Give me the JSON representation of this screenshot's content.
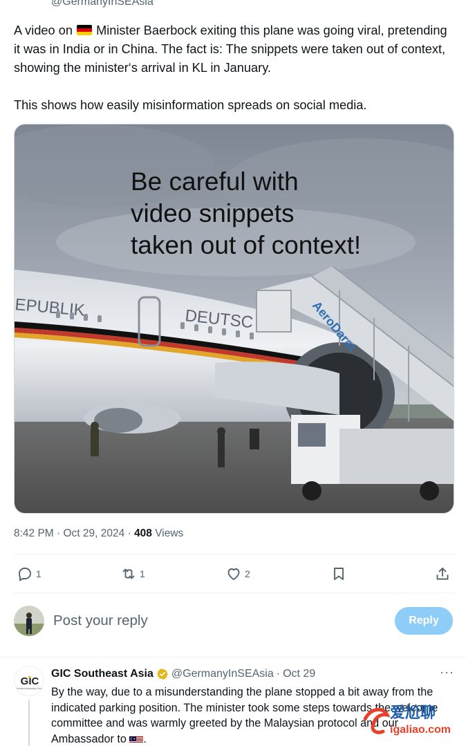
{
  "tweet": {
    "handle_top": "@GermanyInSEAsia",
    "text_line1_pre": "A video on",
    "text_line1_post": "Minister Baerbock exiting this plane was going viral, pretending it was in India or in China.  The fact is: The snippets were taken out of context, showing the minister‘s arrival in KL in January.",
    "text_line2": "This shows how easily misinformation spreads on social media.",
    "flag": "germany-flag"
  },
  "media": {
    "overlay_line1": "Be careful with",
    "overlay_line2": "video snippets",
    "overlay_line3": "taken out of context!",
    "fuselage_text_left": "EPUBLIK",
    "fuselage_text_right": "DEUTSC",
    "stairs_brand": "AeroDarat"
  },
  "meta": {
    "time": "8:42 PM",
    "sep1": " · ",
    "date": "Oct 29, 2024",
    "sep2": " · ",
    "views_count": "408",
    "views_label": " Views"
  },
  "actions": {
    "replies": "1",
    "reposts": "1",
    "likes": "2"
  },
  "reply_box": {
    "placeholder": "Post your reply",
    "button": "Reply"
  },
  "reply": {
    "avatar_text": "GIC",
    "avatar_subtext": "German Information Centre",
    "name": "GIC Southeast Asia",
    "handle": "@GermanyInSEAsia",
    "sep": " · ",
    "date": "Oct 29",
    "more": "···",
    "text": "By the way, due to a misunderstanding the plane stopped a bit away from the indicated parking position. The minister took some steps towards the welcome committee and was warmly greeted by the Malaysian protocol and our Ambassador to",
    "text_end": "."
  },
  "watermark": {
    "line1": "爱尬聊",
    "line2": "igaliao.com"
  },
  "colors": {
    "accent": "#1d9bf0",
    "reply_button_disabled": "#8ecdf7",
    "muted": "#536471",
    "verified_gold": "#e2b719"
  }
}
